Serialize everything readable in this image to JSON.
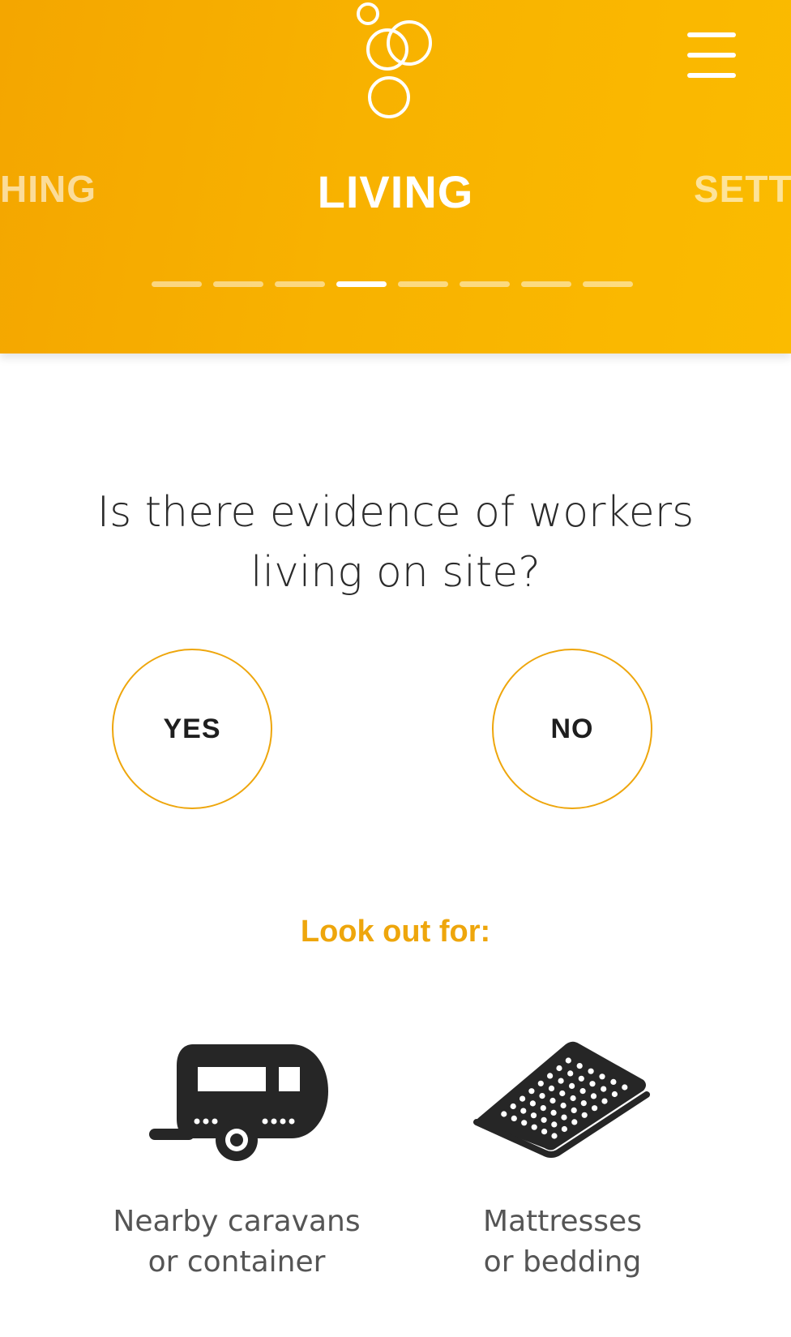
{
  "header": {
    "tabs": {
      "prev": "HING",
      "active": "LIVING",
      "next": "SETT"
    },
    "progress": {
      "total": 8,
      "current": 4
    },
    "colors": {
      "header_bg": "#F8B200",
      "accent": "#EEA60C",
      "text_dark": "#2B2B2B"
    },
    "icons": {
      "logo": "bubbles-logo-icon",
      "menu": "hamburger-menu-icon"
    }
  },
  "question": {
    "line1": "Is there evidence of workers",
    "line2": "living on site?"
  },
  "answers": {
    "yes": "YES",
    "no": "NO"
  },
  "lookout": {
    "title": "Look out for:",
    "items": [
      {
        "icon": "caravan-icon",
        "line1": "Nearby caravans",
        "line2": "or container"
      },
      {
        "icon": "mattress-icon",
        "line1": "Mattresses",
        "line2": "or bedding"
      }
    ]
  }
}
